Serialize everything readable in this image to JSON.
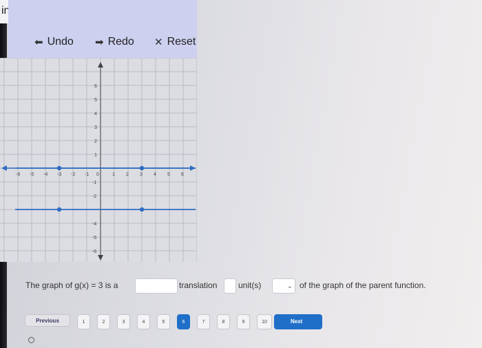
{
  "app": {
    "title_fragment": "ine"
  },
  "toolbar": {
    "undo_label": "Undo",
    "redo_label": "Redo",
    "reset_label": "Reset",
    "undo_icon": "arrow-left-icon",
    "redo_icon": "arrow-right-icon",
    "reset_icon": "close-icon"
  },
  "graph": {
    "x_range": [
      -6,
      6
    ],
    "y_range": [
      -6,
      6
    ],
    "x_ticks": [
      "-6",
      "-5",
      "-4",
      "-3",
      "-2",
      "-1",
      "0",
      "1",
      "2",
      "3",
      "4",
      "5",
      "6"
    ],
    "y_ticks": [
      "6",
      "5",
      "4",
      "3",
      "2",
      "1",
      "-1",
      "-2",
      "-4",
      "-5",
      "-6"
    ],
    "lines": [
      {
        "name": "parent",
        "y": 0,
        "points": [
          [
            -3,
            0
          ],
          [
            3,
            0
          ]
        ]
      },
      {
        "name": "translated",
        "y": -3,
        "points": [
          [
            -3,
            -3
          ],
          [
            3,
            -3
          ]
        ]
      }
    ],
    "line_color": "#2f6cc2",
    "axis_color": "#2f6cc2"
  },
  "question": {
    "prefix": "The graph of g(x) = 3 is a",
    "word_translation": "translation",
    "word_units": "unit(s)",
    "suffix": "of the graph of the parent function."
  },
  "nav": {
    "previous_label": "Previous",
    "pages": [
      "1",
      "2",
      "3",
      "4",
      "5",
      "6",
      "7",
      "8",
      "9",
      "10"
    ],
    "current_page": "6",
    "next_label": "Next"
  },
  "colors": {
    "accent": "#1f6fc9",
    "panel": "#cdd0ef"
  }
}
